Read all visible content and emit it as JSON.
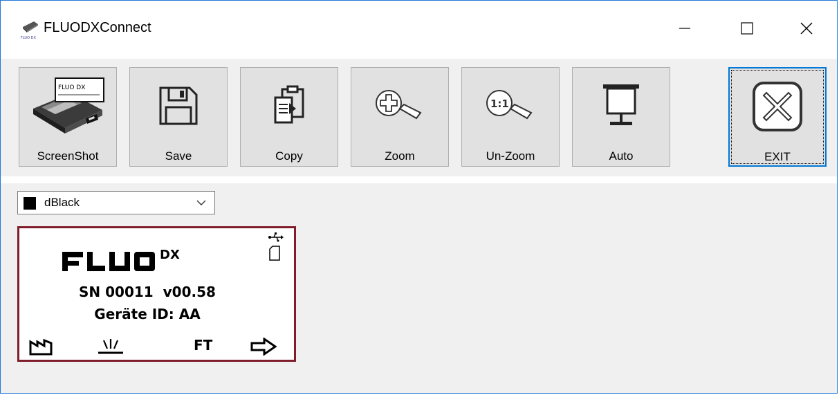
{
  "window": {
    "title": "FLUODXConnect",
    "border_color": "#1e78d7"
  },
  "toolbar": {
    "buttons": [
      {
        "label": "ScreenShot",
        "icon": "device-camera-icon"
      },
      {
        "label": "Save",
        "icon": "floppy-disk-icon"
      },
      {
        "label": "Copy",
        "icon": "clipboard-copy-icon"
      },
      {
        "label": "Zoom",
        "icon": "zoom-in-icon"
      },
      {
        "label": "Un-Zoom",
        "icon": "zoom-reset-icon"
      },
      {
        "label": "Auto",
        "icon": "projector-screen-icon"
      },
      {
        "label": "EXIT",
        "icon": "close-box-icon"
      }
    ]
  },
  "color_select": {
    "value": "dBlack",
    "swatch_color": "#000000"
  },
  "device_display": {
    "logo": "FLUO",
    "logo_suffix": "DX",
    "serial_line": "SN 00011  v00.58",
    "device_id_line": "Geräte ID: AA",
    "soft_key_ft": "FT",
    "frame_color": "#7f1d2a",
    "screenshot_logo_text": "FLUO DX"
  }
}
